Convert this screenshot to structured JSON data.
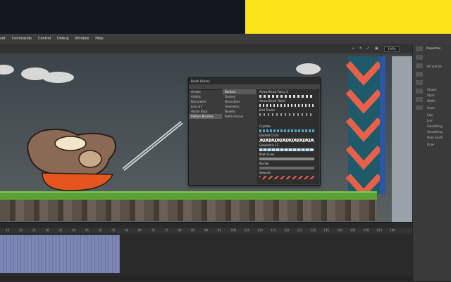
{
  "menu": [
    "set",
    "Commands",
    "Control",
    "Debug",
    "Window",
    "Help"
  ],
  "stage": {
    "zoom": "100%"
  },
  "properties": {
    "tab": "Properties",
    "sections": [
      "Fill and Str",
      "Stroke:",
      "Style:",
      "Width:",
      "Scale:",
      "Cap:",
      "Join:",
      "Smoothing",
      "Smoothing",
      "Paint brush",
      "Draw"
    ]
  },
  "brush_library": {
    "title": "Brush Library",
    "categories": [
      "Arrows",
      "Artistic",
      "Decorative",
      "Line art",
      "Vector Pack",
      "Pattern Brushes"
    ],
    "subcategories": [
      "Borders",
      "Dashed",
      "Decorative",
      "Geometric",
      "Novelty",
      "PatternArrow"
    ],
    "brushes": [
      "Arrow Brush Fancy 2",
      "Arrow Brush Floral",
      "Bird Tracks",
      "Crystals",
      "Dashed Circle",
      "Geometric 13",
      "Multi Lines",
      "Nucleo",
      "Sawcom"
    ]
  },
  "timeline": {
    "ticks": [
      "15",
      "20",
      "25",
      "30",
      "35",
      "40",
      "45",
      "50",
      "55",
      "60",
      "65",
      "70",
      "75",
      "80",
      "85",
      "90",
      "95",
      "100",
      "105",
      "110",
      "115",
      "120",
      "125",
      "130",
      "135",
      "140",
      "145",
      "150",
      "155",
      "160"
    ]
  },
  "colors": {
    "yellow": "#fde31a",
    "grass": "#5aa036",
    "frames": "#7d87b5",
    "zigzag_red": "#e9604a",
    "zigzag_green": "#1aa07a",
    "zigzag_blue": "#2d55a6"
  }
}
